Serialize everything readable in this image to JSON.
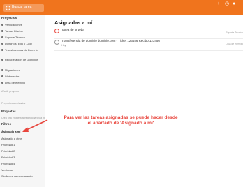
{
  "topbar": {
    "search_placeholder": "Buscar tarea",
    "right_icons": [
      "plus-icon",
      "clock-icon",
      "user-icon"
    ]
  },
  "sidebar": {
    "projects_title": "Proyectos",
    "projects": [
      {
        "label": "Verificaciones"
      },
      {
        "label": "Tareas Diarias"
      },
      {
        "label": "Soporte Técnico"
      },
      {
        "label": "Dominios, Edu y .Gob"
      },
      {
        "label": "Transferencias de Dominio"
      },
      {
        "label": "Recuperación de Dominios"
      },
      {
        "label": "Migraciones"
      },
      {
        "label": "Webmaster"
      },
      {
        "label": "Lista de ejemplo"
      }
    ],
    "add_project": "Añadir proyecto",
    "archived": "Proyectos archivados",
    "labels_title": "Etiquetas",
    "labels_hint": "Crea una etiqueta apretando la tecla @",
    "filters_title": "Filtros",
    "filters": [
      {
        "label": "Asignado a mí"
      },
      {
        "label": "Asignado a otros"
      },
      {
        "label": "Prioridad 1"
      },
      {
        "label": "Prioridad 2"
      },
      {
        "label": "Prioridad 3"
      },
      {
        "label": "Prioridad 4"
      },
      {
        "label": "Ver todas"
      },
      {
        "label": "Sin fecha de vencimiento"
      }
    ]
  },
  "main": {
    "title": "Asignadas a mí",
    "tasks": [
      {
        "title": "Tarea de prueba",
        "meta": "",
        "right": "Soporte Técnico"
      },
      {
        "title": "Transferencia de dominio dominio.com - Ticket 123456 Recibo 123456",
        "meta": "Hoy",
        "right": "Lista de ejemplo"
      }
    ]
  },
  "annotation": {
    "line1": "Para ver las tareas asignadas se puede hacer desde",
    "line2": "el apartado de 'Asignado a mí'",
    "color": "#e8453c"
  },
  "colors": {
    "accent": "#f0741d"
  }
}
